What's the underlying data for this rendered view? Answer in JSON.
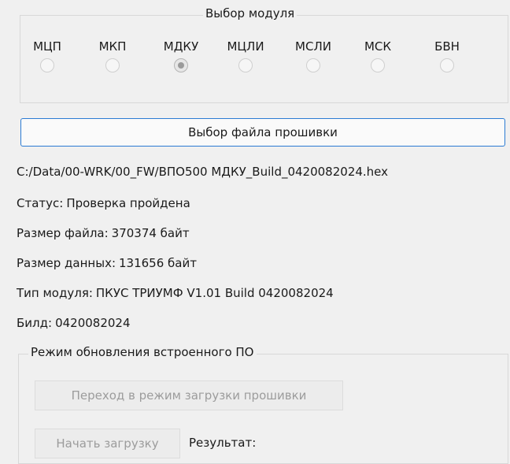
{
  "module_select": {
    "title": "Выбор модуля",
    "options": [
      {
        "label": "МЦП",
        "checked": false
      },
      {
        "label": "МКП",
        "checked": false
      },
      {
        "label": "МДКУ",
        "checked": true
      },
      {
        "label": "МЦЛИ",
        "checked": false
      },
      {
        "label": "МСЛИ",
        "checked": false
      },
      {
        "label": "МСК",
        "checked": false
      },
      {
        "label": "БВН",
        "checked": false
      }
    ]
  },
  "file_button_label": "Выбор файла прошивки",
  "file_path": "C:/Data/00-WRK/00_FW/ВПО500 МДКУ_Build_0420082024.hex",
  "info": {
    "status_label": "Статус:",
    "status_value": "Проверка пройдена",
    "file_size_label": "Размер файла:",
    "file_size_value": "370374 байт",
    "data_size_label": "Размер данных:",
    "data_size_value": "131656 байт",
    "module_type_label": "Тип модуля:",
    "module_type_value": "ПКУС ТРИУМФ V1.01 Build 0420082024",
    "build_label": "Билд:",
    "build_value": "0420082024"
  },
  "update": {
    "title": "Режим обновления встроенного ПО",
    "enter_bootloader_label": "Переход в режим загрузки прошивки",
    "start_upload_label": "Начать загрузку",
    "result_label": "Результат:"
  }
}
